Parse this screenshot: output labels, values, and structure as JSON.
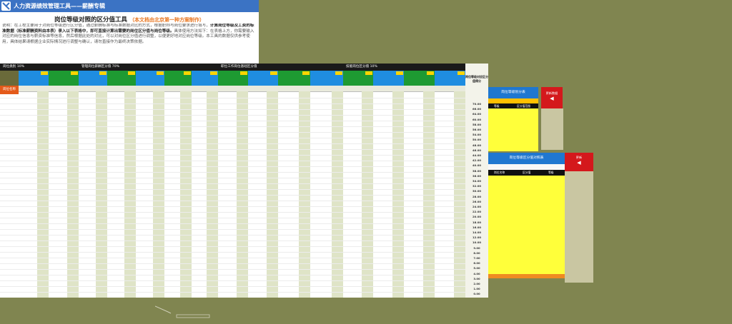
{
  "app": {
    "title": "人力资源绩效管理工具——薪酬专辑"
  },
  "notice": {
    "heading": "岗位等级对照的区分值工具",
    "heading_tag": "（本文档由北京第一种方案制作）",
    "body_lead": "说明：在工程主要用于对岗位等级进行区分值，通过薪酬标准与标准数据对比的方式，根据职称与岗位要求进行填写，",
    "body_bold": "计算岗位等级及工资的标准数据（标准薪酬资料由本表）录入以下表格中，即可直接计算出需要的岗位区分值与岗位等级。",
    "body_tail": "具体使用方法如下：在表格上方，你需要输入对应的岗位信息与薪资标准等信息，然后根据此处的对比，可以对岗位区分值进行调整，以便更好地对应岗位等级。本工具的数据仅供参考使用，具体结果请根据企业实际情况进行调整与确认，请勿直接作为最终决策依据。"
  },
  "grid": {
    "bands": [
      {
        "label": "岗位类别 10%",
        "color": "#1a1a1a"
      },
      {
        "label": "管理岗位薪酬区分值 70%",
        "color": "#1a1a1a"
      },
      {
        "label": "职位工作岗位基础区分值",
        "color": "#1a1a1a"
      },
      {
        "label": "技能岗位区分值 10%",
        "color": "#1a1a1a"
      }
    ],
    "side_header": "岗位等级对应区分值得分",
    "red_label": "岗位名称"
  },
  "side_values": [
    "70.00",
    "66.00",
    "64.00",
    "60.00",
    "58.00",
    "56.00",
    "54.00",
    "50.00",
    "48.00",
    "46.00",
    "44.00",
    "42.00",
    "40.00",
    "38.00",
    "36.00",
    "34.00",
    "32.00",
    "30.00",
    "28.00",
    "26.00",
    "24.00",
    "22.00",
    "20.00",
    "18.00",
    "16.00",
    "14.00",
    "12.00",
    "10.00",
    "9.00",
    "8.00",
    "7.00",
    "6.00",
    "5.00",
    "4.00",
    "3.00",
    "2.00",
    "1.00",
    "0.00"
  ],
  "panel_a": {
    "title": "岗位等级划分表",
    "button_label": "更新数据",
    "col1": "等级",
    "col2": "区分值范围"
  },
  "panel_b": {
    "title": "岗位等级区分值对照表",
    "col1": "岗位名称",
    "col2": "区分值",
    "col3": "等级",
    "button_label": "更新"
  },
  "colors": {
    "background": "#808550",
    "title_blue": "#3b73c4",
    "header_blue": "#1f77d0",
    "header_green": "#1e9a32",
    "highlight_yellow": "#ffff3a",
    "accent_orange": "#ef8a22",
    "alert_red": "#d4181c"
  }
}
